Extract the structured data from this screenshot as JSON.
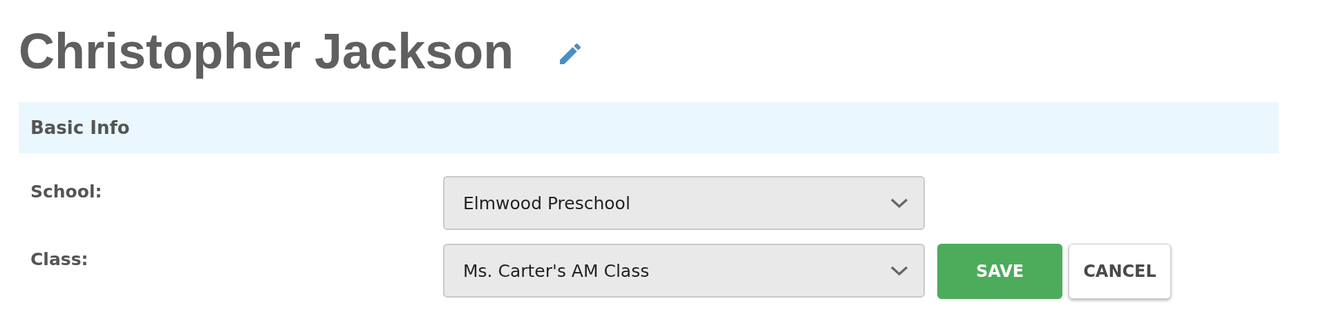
{
  "title": "Christopher Jackson",
  "section": {
    "title": "Basic Info"
  },
  "fields": [
    {
      "label": "School:",
      "value": "Elmwood Preschool"
    },
    {
      "label": "Class:",
      "value": "Ms. Carter's AM Class"
    }
  ],
  "actions": [
    {
      "label": "SAVE",
      "kind": "primary"
    },
    {
      "label": "CANCEL",
      "kind": "secondary"
    }
  ]
}
